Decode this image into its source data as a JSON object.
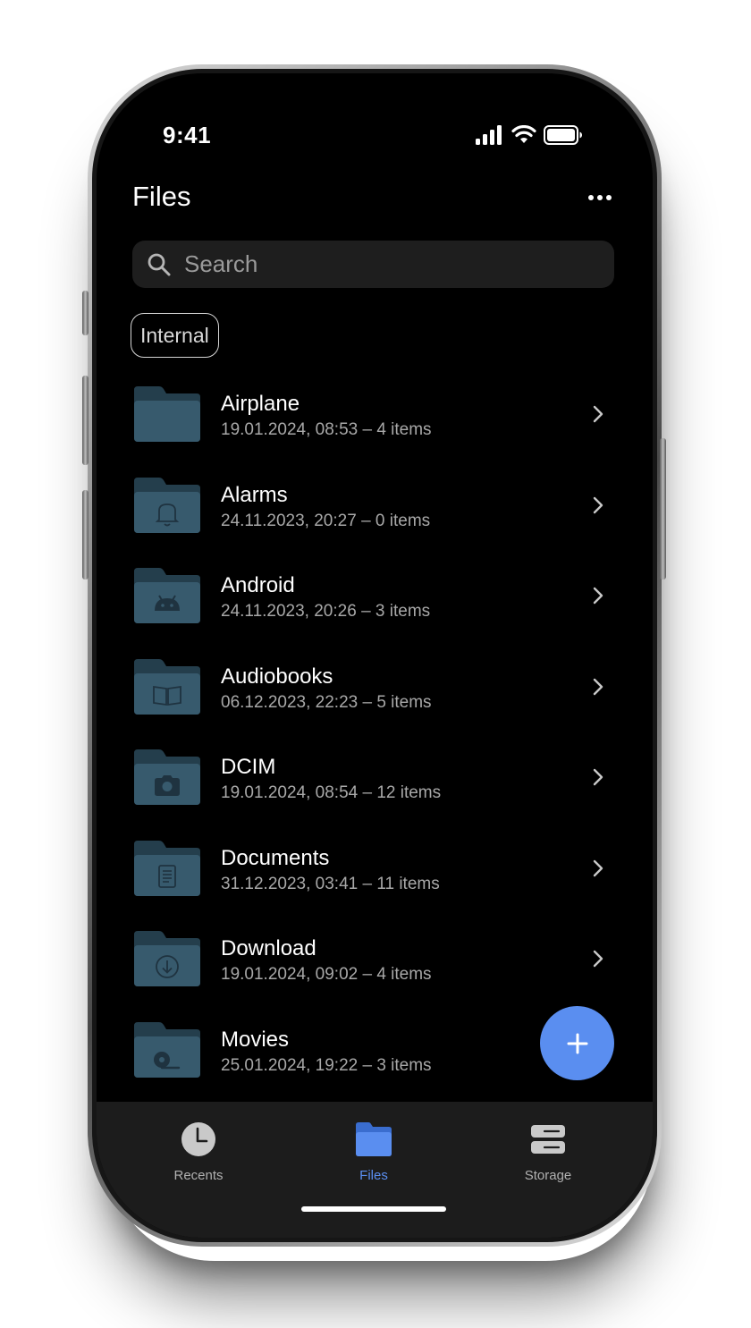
{
  "status_bar": {
    "time": "9:41",
    "icons": [
      "cellular-signal-icon",
      "wifi-icon",
      "battery-icon"
    ]
  },
  "header": {
    "title": "Files",
    "more_icon": "more-horizontal-icon"
  },
  "search": {
    "placeholder": "Search",
    "value": "",
    "icon": "search-icon"
  },
  "filter_chip": {
    "label": "Internal"
  },
  "folders": [
    {
      "name": "Airplane",
      "meta": "19.01.2024, 08:53 – 4 items",
      "icon": "folder-icon"
    },
    {
      "name": "Alarms",
      "meta": "24.11.2023, 20:27 – 0 items",
      "icon": "folder-bell-icon"
    },
    {
      "name": "Android",
      "meta": "24.11.2023, 20:26 – 3 items",
      "icon": "folder-android-icon"
    },
    {
      "name": "Audiobooks",
      "meta": "06.12.2023, 22:23 – 5 items",
      "icon": "folder-book-icon"
    },
    {
      "name": "DCIM",
      "meta": "19.01.2024, 08:54 – 12 items",
      "icon": "folder-camera-icon"
    },
    {
      "name": "Documents",
      "meta": "31.12.2023, 03:41 – 11 items",
      "icon": "folder-document-icon"
    },
    {
      "name": "Download",
      "meta": "19.01.2024, 09:02 – 4 items",
      "icon": "folder-download-icon"
    },
    {
      "name": "Movies",
      "meta": "25.01.2024, 19:22 – 3 items",
      "icon": "folder-movie-icon"
    }
  ],
  "fab": {
    "icon": "plus-icon"
  },
  "bottom_nav": {
    "items": [
      {
        "label": "Recents",
        "icon": "clock-icon",
        "active": false
      },
      {
        "label": "Files",
        "icon": "folder-icon",
        "active": true
      },
      {
        "label": "Storage",
        "icon": "storage-icon",
        "active": false
      }
    ]
  },
  "colors": {
    "background": "#000000",
    "accent": "#5a8ef0",
    "folder": "#2f4d5e",
    "surface": "#1e1e1e"
  }
}
